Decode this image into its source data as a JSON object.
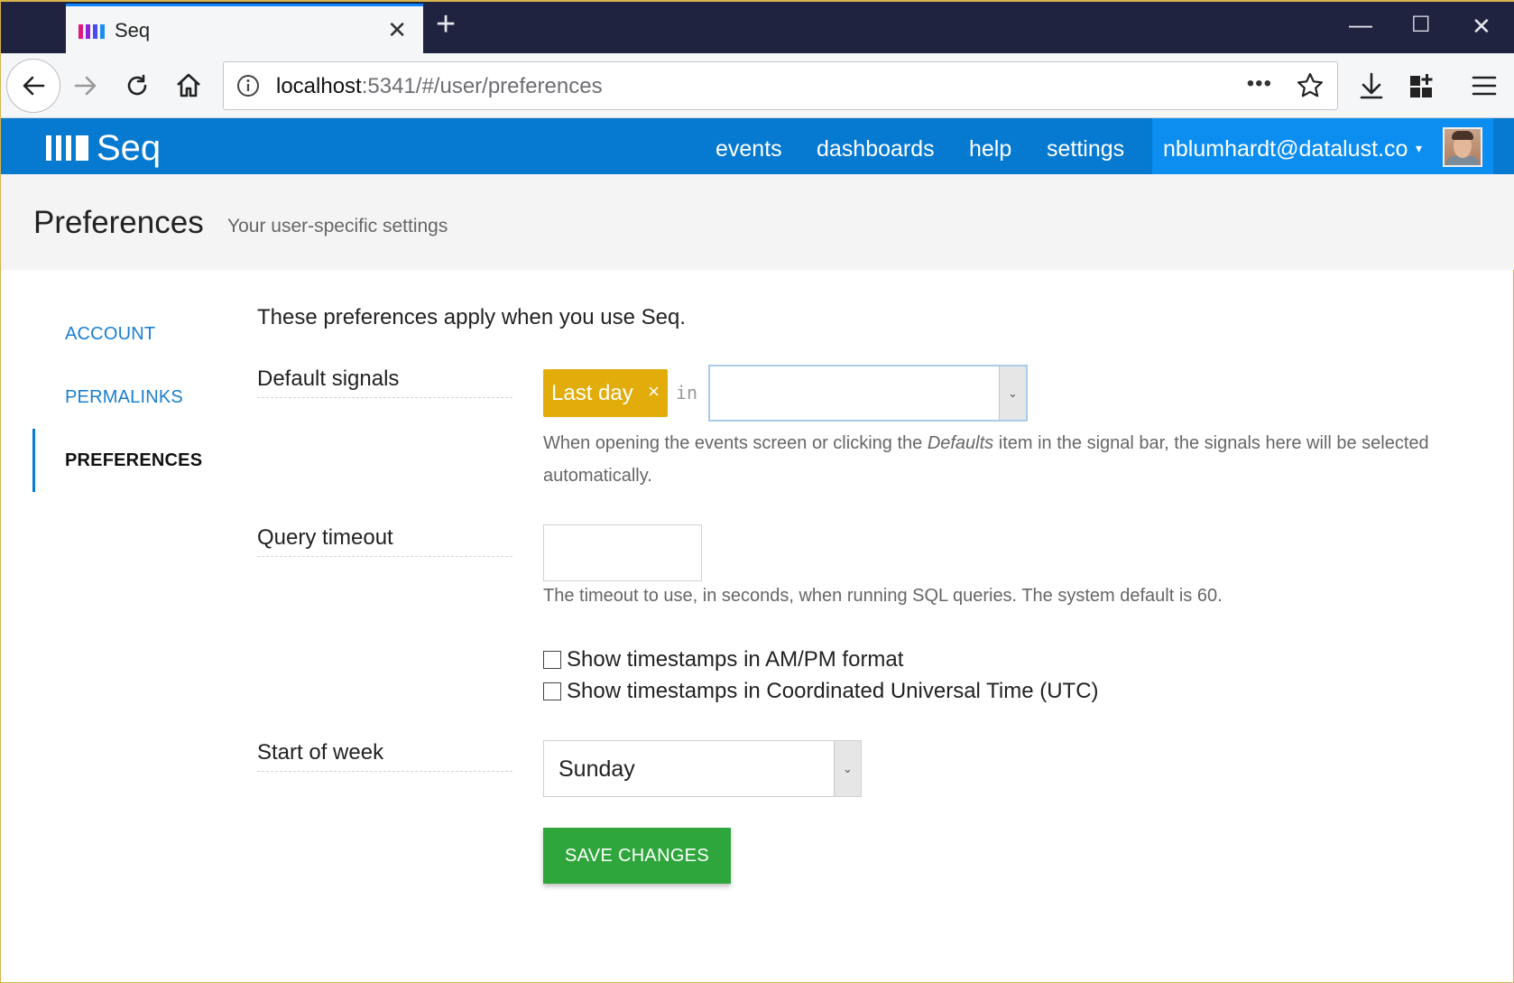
{
  "browser": {
    "tab_title": "Seq",
    "tab_logo_colors": [
      "#e0197d",
      "#8e24d8",
      "#4b4bf0",
      "#1a8ef0"
    ],
    "url_host": "localhost",
    "url_rest": ":5341/#/user/preferences",
    "url_more_label": "•••",
    "new_tab_label": "+",
    "tab_close_label": "✕",
    "window_controls": {
      "minimize": "—",
      "maximize": "☐",
      "close": "✕"
    },
    "icons": [
      "back-arrow-icon",
      "forward-arrow-icon",
      "reload-icon",
      "home-icon",
      "info-icon",
      "bookmark-star-icon",
      "download-icon",
      "extensions-icon",
      "hamburger-menu-icon"
    ]
  },
  "seq": {
    "logo_text": "Seq",
    "nav": {
      "events": "events",
      "dashboards": "dashboards",
      "help": "help",
      "settings": "settings"
    },
    "user_email": "nblumhardt@datalust.co",
    "user_caret": "▾",
    "brand_color": "#0679d0"
  },
  "page": {
    "title": "Preferences",
    "subtitle": "Your user-specific settings"
  },
  "sidenav": {
    "account": "ACCOUNT",
    "permalinks": "PERMALINKS",
    "preferences": "PREFERENCES",
    "active": "PREFERENCES"
  },
  "content": {
    "intro": "These preferences apply when you use Seq.",
    "default_signals": {
      "label": "Default signals",
      "chip_label": "Last day",
      "chip_remove": "×",
      "in_label": "in",
      "select_value": "",
      "select_caret": "⌄",
      "help_before": "When opening the events screen or clicking the ",
      "help_em": "Defaults",
      "help_after": " item in the signal bar, the signals here will be selected automatically.",
      "chip_color": "#e2ad0a"
    },
    "query_timeout": {
      "label": "Query timeout",
      "value": "",
      "help": "The timeout to use, in seconds, when running SQL queries. The system default is 60."
    },
    "checkboxes": {
      "ampm": {
        "label": "Show timestamps in AM/PM format",
        "checked": false
      },
      "utc": {
        "label": "Show timestamps in Coordinated Universal Time (UTC)",
        "checked": false
      }
    },
    "start_of_week": {
      "label": "Start of week",
      "value": "Sunday",
      "caret": "⌄"
    },
    "save_label": "SAVE CHANGES",
    "save_color": "#2ea63c"
  }
}
